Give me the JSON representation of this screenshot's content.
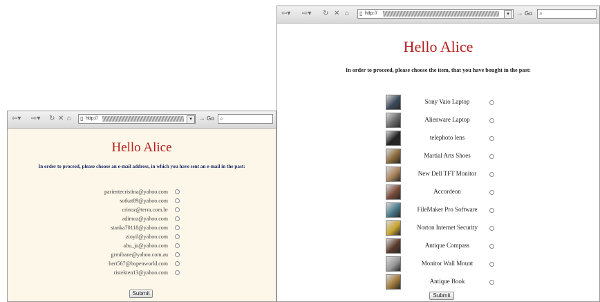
{
  "left_window": {
    "url_prefix": "http://",
    "go_label": "Go",
    "title": "Hello Alice",
    "instruction": "In order to proceed, please choose an e-mail address, in which you have sent an e-mail in the past:",
    "emails": [
      "parientecristina@yahoo.com",
      "sotkat89@yahoo.com",
      "crinoz@terra.com.br",
      "adimoz@yahoo.com",
      "stanka70118@yahoo.com",
      "zioyil@yahoo.com",
      "abu_jo@yahoo.com",
      "grmibane@yahoo.com.au",
      "bert567@bopenworld.com",
      "ristekten13@yahoo.com"
    ],
    "submit_label": "Submit"
  },
  "right_window": {
    "url_prefix": "http://",
    "go_label": "Go",
    "title": "Hello Alice",
    "instruction": "In order to proceed, please choose the item, that you have bought in the past:",
    "items": [
      {
        "label": "Sony Vaio Laptop",
        "thumb_color": "#3c4a5a"
      },
      {
        "label": "Alienware Laptop",
        "thumb_color": "#6a6a6a"
      },
      {
        "label": "telephoto lens",
        "thumb_color": "#222222"
      },
      {
        "label": "Martial Arts Shoes",
        "thumb_color": "#8b6a3a"
      },
      {
        "label": "New Dell TFT Monitor",
        "thumb_color": "#a8825a"
      },
      {
        "label": "Accordeon",
        "thumb_color": "#7a4a3a"
      },
      {
        "label": "FileMaker Pro Software",
        "thumb_color": "#4a7a8a"
      },
      {
        "label": "Norton Internet Security",
        "thumb_color": "#c9a531"
      },
      {
        "label": "Antique Compass",
        "thumb_color": "#5a3a2a"
      },
      {
        "label": "Monitor Wall Mount",
        "thumb_color": "#9a9a9a"
      },
      {
        "label": "Antique Book",
        "thumb_color": "#a07a3a"
      }
    ],
    "submit_label": "Submit"
  },
  "colors": {
    "title_red": "#b81e1e",
    "left_background": "#fcf7e8",
    "left_instruction": "#1c2a6b",
    "right_instruction": "#222222"
  }
}
